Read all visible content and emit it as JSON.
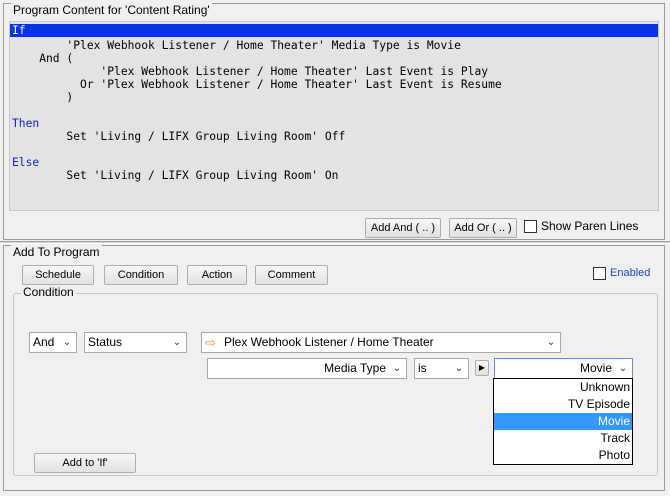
{
  "top": {
    "title": "Program Content for 'Content Rating'",
    "code": [
      {
        "text": "If",
        "kw": true
      },
      {
        "text": "        'Plex Webhook Listener / Home Theater' Media Type is Movie",
        "kw": false
      },
      {
        "text": "    And (",
        "kw": false
      },
      {
        "text": "             'Plex Webhook Listener / Home Theater' Last Event is Play",
        "kw": false
      },
      {
        "text": "          Or 'Plex Webhook Listener / Home Theater' Last Event is Resume",
        "kw": false
      },
      {
        "text": "        )",
        "kw": false
      },
      {
        "text": "",
        "kw": false
      },
      {
        "text": "Then",
        "kw": true
      },
      {
        "text": "        Set 'Living / LIFX Group Living Room' Off",
        "kw": false
      },
      {
        "text": "",
        "kw": false
      },
      {
        "text": "Else",
        "kw": true
      },
      {
        "text": "        Set 'Living / LIFX Group Living Room' On",
        "kw": false
      }
    ],
    "add_and_label": "Add And ( .. )",
    "add_or_label": "Add Or ( .. )",
    "paren_lines_label": "Show Paren Lines"
  },
  "bottom": {
    "title": "Add To Program",
    "buttons": [
      "Schedule",
      "Condition",
      "Action",
      "Comment"
    ],
    "enabled_label": "Enabled",
    "condition_title": "Condition",
    "and_value": "And",
    "status_value": "Status",
    "device_value": "Plex Webhook Listener / Home Theater",
    "property_value": "Media Type",
    "operator_value": "is",
    "value_selected": "Movie",
    "dropdown_options": [
      "Unknown",
      "TV Episode",
      "Movie",
      "Track",
      "Photo"
    ],
    "add_to_if_label": "Add to 'If'"
  },
  "colors": {
    "keyword": "#1020d0",
    "selection_bar": "#0a33e0",
    "list_selection": "#3399ff",
    "enabled_text": "#1a3fcf"
  },
  "icons": {
    "device_icon": "right-arrow-icon",
    "expand_icon": "play-triangle-icon"
  }
}
